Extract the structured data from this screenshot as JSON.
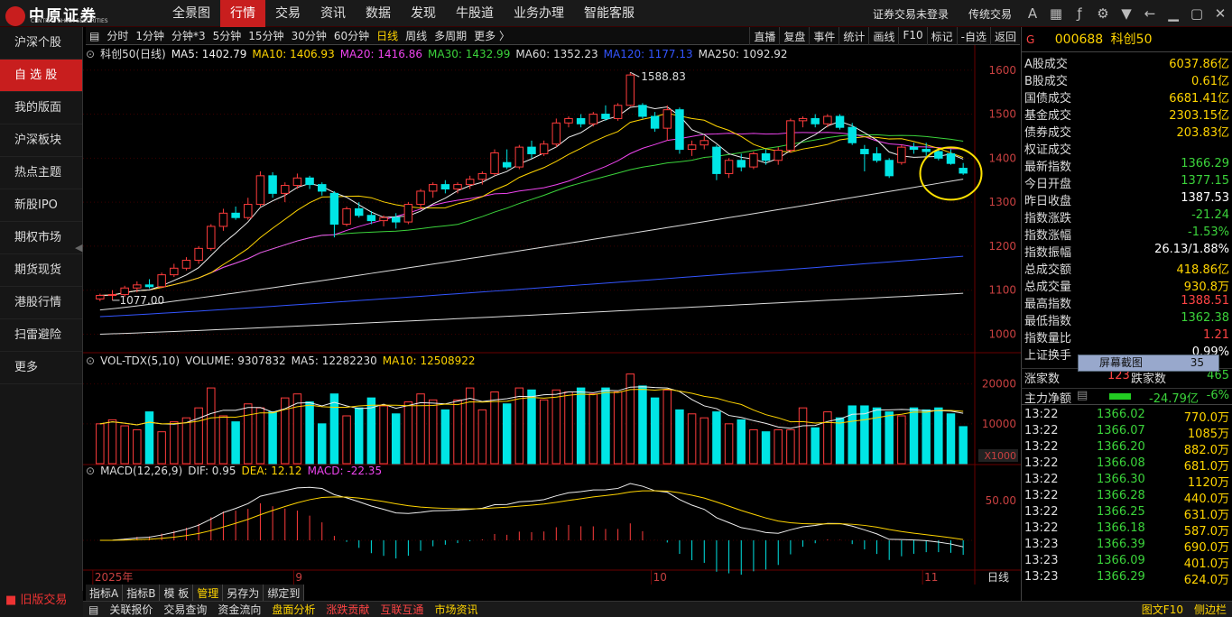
{
  "app": {
    "logo_text": "中原证券",
    "logo_subtext": "CENTRAL CHINA SECURITIES"
  },
  "menu": [
    "全景图",
    "行情",
    "交易",
    "资讯",
    "数据",
    "发现",
    "牛股道",
    "业务办理",
    "智能客服"
  ],
  "menu_active": "行情",
  "topright": {
    "login_status": "证券交易未登录",
    "mode": "传统交易"
  },
  "sidebar": [
    "沪深个股",
    "自 选 股",
    "我的版面",
    "沪深板块",
    "热点主题",
    "新股IPO",
    "期权市场",
    "期货现货",
    "港股行情",
    "扫雷避险",
    "更多"
  ],
  "sidebar_active": "自 选 股",
  "old_version": "旧版交易",
  "periods": [
    "分时",
    "1分钟",
    "分钟*3",
    "5分钟",
    "15分钟",
    "30分钟",
    "60分钟",
    "日线",
    "周线",
    "多周期",
    "更多 〉"
  ],
  "period_active": "日线",
  "chart_tools": [
    "直播",
    "复盘",
    "事件",
    "统计",
    "画线",
    "F10",
    "标记",
    "-自选",
    "返回"
  ],
  "ma_legend": [
    {
      "text": "科创50(日线)",
      "color": "#dddddd"
    },
    {
      "text": "MA5: 1402.79",
      "color": "#eeeeee"
    },
    {
      "text": "MA10: 1406.93",
      "color": "#ffd400"
    },
    {
      "text": "MA20: 1416.86",
      "color": "#ee44ee"
    },
    {
      "text": "MA30: 1432.99",
      "color": "#3bd33b"
    },
    {
      "text": "MA60: 1352.23",
      "color": "#dddddd"
    },
    {
      "text": "MA120: 1177.13",
      "color": "#3355ff"
    },
    {
      "text": "MA250: 1092.92",
      "color": "#dddddd"
    }
  ],
  "vol_legend": [
    {
      "text": "VOL-TDX(5,10)",
      "color": "#dddddd"
    },
    {
      "text": "VOLUME: 9307832",
      "color": "#dddddd"
    },
    {
      "text": "MA5: 12282230",
      "color": "#dddddd"
    },
    {
      "text": "MA10: 12508922",
      "color": "#ffd400"
    }
  ],
  "macd_legend": [
    {
      "text": "MACD(12,26,9)",
      "color": "#dddddd"
    },
    {
      "text": "DIF: 0.95",
      "color": "#dddddd"
    },
    {
      "text": "DEA: 12.12",
      "color": "#ffd400"
    },
    {
      "text": "MACD: -22.35",
      "color": "#ee44ee"
    }
  ],
  "price_axis": [
    "1600",
    "1500",
    "1400",
    "1300",
    "1200",
    "1100",
    "1000"
  ],
  "vol_axis": [
    "20000",
    "10000",
    "X1000"
  ],
  "macd_axis": [
    "50.00"
  ],
  "date_axis": [
    "2025年",
    "9",
    "10",
    "11"
  ],
  "period_label": "日线",
  "annotations": {
    "high": "1588.83",
    "low": "1077.00"
  },
  "bottom_tabs": [
    "指标A",
    "指标B",
    "模 板",
    "管理",
    "另存为",
    "绑定到"
  ],
  "bottom_tab_active": "管理",
  "statusbar": [
    {
      "text": "关联报价",
      "color": "#dddddd"
    },
    {
      "text": "交易查询",
      "color": "#dddddd"
    },
    {
      "text": "资金流向",
      "color": "#dddddd"
    },
    {
      "text": "盘面分析",
      "color": "#ffd400"
    },
    {
      "text": "涨跌贡献",
      "color": "#ff4444"
    },
    {
      "text": "互联互通",
      "color": "#ff4444"
    },
    {
      "text": "市场资讯",
      "color": "#ffd400"
    },
    {
      "text": "图文F10",
      "color": "#ffd400"
    },
    {
      "text": "侧边栏",
      "color": "#ffd400"
    }
  ],
  "stock": {
    "code": "000688",
    "name": "科创50",
    "marker": "G"
  },
  "quote_rows": [
    {
      "label": "A股成交",
      "value": "6037.86亿",
      "color": "#ffd400"
    },
    {
      "label": "B股成交",
      "value": "0.61亿",
      "color": "#ffd400"
    },
    {
      "label": "国债成交",
      "value": "6681.41亿",
      "color": "#ffd400"
    },
    {
      "label": "基金成交",
      "value": "2303.15亿",
      "color": "#ffd400"
    },
    {
      "label": "债券成交",
      "value": "203.83亿",
      "color": "#ffd400"
    },
    {
      "label": "权证成交",
      "value": "",
      "color": "#ffd400"
    },
    {
      "label": "最新指数",
      "value": "1366.29",
      "color": "#3bd33b"
    },
    {
      "label": "今日开盘",
      "value": "1377.15",
      "color": "#3bd33b"
    },
    {
      "label": "昨日收盘",
      "value": "1387.53",
      "color": "#ffffff"
    },
    {
      "label": "指数涨跌",
      "value": "-21.24",
      "color": "#3bd33b"
    },
    {
      "label": "指数涨幅",
      "value": "-1.53%",
      "color": "#3bd33b"
    },
    {
      "label": "指数振幅",
      "value": "26.13/1.88%",
      "color": "#ffffff"
    },
    {
      "label": "总成交额",
      "value": "418.86亿",
      "color": "#ffd400"
    },
    {
      "label": "总成交量",
      "value": "930.8万",
      "color": "#ffd400"
    },
    {
      "label": "最高指数",
      "value": "1388.51",
      "color": "#ff4444"
    },
    {
      "label": "最低指数",
      "value": "1362.38",
      "color": "#3bd33b"
    },
    {
      "label": "指数量比",
      "value": "1.21",
      "color": "#ff4444"
    },
    {
      "label": "上证换手",
      "value": "0.99%",
      "color": "#ffffff"
    }
  ],
  "updown": {
    "label_up": "涨家数",
    "value_up": "123",
    "label_down": "跌家数",
    "value_down": "465"
  },
  "main_flow": {
    "label": "主力净额",
    "value": "-24.79亿",
    "pct": "-6%"
  },
  "popup": {
    "text": "屏幕截图",
    "count": "35"
  },
  "ticks": [
    {
      "time": "13:22",
      "price": "1366.02",
      "vol": "770.0万"
    },
    {
      "time": "13:22",
      "price": "1366.07",
      "vol": "1085万"
    },
    {
      "time": "13:22",
      "price": "1366.20",
      "vol": "882.0万"
    },
    {
      "time": "13:22",
      "price": "1366.08",
      "vol": "681.0万"
    },
    {
      "time": "13:22",
      "price": "1366.30",
      "vol": "1120万"
    },
    {
      "time": "13:22",
      "price": "1366.28",
      "vol": "440.0万"
    },
    {
      "time": "13:22",
      "price": "1366.25",
      "vol": "631.0万"
    },
    {
      "time": "13:22",
      "price": "1366.18",
      "vol": "587.0万"
    },
    {
      "time": "13:23",
      "price": "1366.39",
      "vol": "690.0万"
    },
    {
      "time": "13:23",
      "price": "1366.09",
      "vol": "401.0万"
    },
    {
      "time": "13:23",
      "price": "1366.29",
      "vol": "624.0万"
    }
  ],
  "chart_data": {
    "type": "candlestick",
    "ylim": [
      960,
      1620
    ],
    "candles": [
      [
        1080,
        1092,
        1075,
        1088
      ],
      [
        1088,
        1100,
        1077,
        1090
      ],
      [
        1090,
        1110,
        1085,
        1105
      ],
      [
        1105,
        1120,
        1095,
        1112
      ],
      [
        1112,
        1125,
        1104,
        1108
      ],
      [
        1108,
        1140,
        1105,
        1135
      ],
      [
        1135,
        1160,
        1130,
        1150
      ],
      [
        1150,
        1175,
        1145,
        1168
      ],
      [
        1168,
        1200,
        1160,
        1195
      ],
      [
        1195,
        1250,
        1190,
        1245
      ],
      [
        1245,
        1285,
        1235,
        1275
      ],
      [
        1275,
        1290,
        1260,
        1265
      ],
      [
        1265,
        1310,
        1260,
        1295
      ],
      [
        1295,
        1370,
        1290,
        1360
      ],
      [
        1360,
        1368,
        1310,
        1320
      ],
      [
        1320,
        1345,
        1300,
        1338
      ],
      [
        1338,
        1365,
        1330,
        1355
      ],
      [
        1355,
        1360,
        1330,
        1340
      ],
      [
        1340,
        1345,
        1315,
        1325
      ],
      [
        1320,
        1325,
        1220,
        1250
      ],
      [
        1250,
        1290,
        1245,
        1285
      ],
      [
        1285,
        1300,
        1265,
        1270
      ],
      [
        1270,
        1280,
        1250,
        1258
      ],
      [
        1258,
        1270,
        1245,
        1265
      ],
      [
        1265,
        1275,
        1240,
        1255
      ],
      [
        1255,
        1300,
        1250,
        1295
      ],
      [
        1295,
        1330,
        1285,
        1325
      ],
      [
        1325,
        1345,
        1310,
        1340
      ],
      [
        1340,
        1350,
        1320,
        1330
      ],
      [
        1330,
        1345,
        1320,
        1340
      ],
      [
        1340,
        1360,
        1330,
        1352
      ],
      [
        1352,
        1370,
        1340,
        1365
      ],
      [
        1365,
        1420,
        1360,
        1412
      ],
      [
        1390,
        1420,
        1375,
        1380
      ],
      [
        1380,
        1430,
        1375,
        1425
      ],
      [
        1425,
        1440,
        1400,
        1410
      ],
      [
        1410,
        1440,
        1405,
        1432
      ],
      [
        1432,
        1490,
        1425,
        1480
      ],
      [
        1480,
        1495,
        1470,
        1490
      ],
      [
        1490,
        1500,
        1470,
        1478
      ],
      [
        1478,
        1505,
        1472,
        1500
      ],
      [
        1500,
        1520,
        1485,
        1490
      ],
      [
        1490,
        1525,
        1485,
        1520
      ],
      [
        1520,
        1595,
        1518,
        1589
      ],
      [
        1520,
        1525,
        1490,
        1495
      ],
      [
        1495,
        1505,
        1460,
        1468
      ],
      [
        1468,
        1520,
        1440,
        1510
      ],
      [
        1510,
        1515,
        1410,
        1420
      ],
      [
        1420,
        1440,
        1405,
        1430
      ],
      [
        1430,
        1450,
        1420,
        1440
      ],
      [
        1425,
        1430,
        1350,
        1365
      ],
      [
        1365,
        1400,
        1355,
        1395
      ],
      [
        1395,
        1410,
        1370,
        1380
      ],
      [
        1380,
        1415,
        1375,
        1410
      ],
      [
        1410,
        1420,
        1385,
        1395
      ],
      [
        1395,
        1425,
        1385,
        1418
      ],
      [
        1418,
        1490,
        1412,
        1485
      ],
      [
        1485,
        1495,
        1470,
        1490
      ],
      [
        1490,
        1500,
        1470,
        1478
      ],
      [
        1478,
        1500,
        1470,
        1495
      ],
      [
        1495,
        1500,
        1465,
        1470
      ],
      [
        1470,
        1480,
        1430,
        1435
      ],
      [
        1420,
        1430,
        1370,
        1410
      ],
      [
        1410,
        1425,
        1390,
        1395
      ],
      [
        1395,
        1400,
        1355,
        1360
      ],
      [
        1390,
        1430,
        1385,
        1425
      ],
      [
        1425,
        1435,
        1410,
        1420
      ],
      [
        1420,
        1435,
        1405,
        1415
      ],
      [
        1415,
        1420,
        1395,
        1400
      ],
      [
        1410,
        1420,
        1385,
        1388
      ],
      [
        1377,
        1389,
        1362,
        1366
      ]
    ],
    "ma_values": {
      "MA5": 1402.79,
      "MA10": 1406.93,
      "MA20": 1416.86,
      "MA30": 1432.99,
      "MA60": 1352.23,
      "MA120": 1177.13,
      "MA250": 1092.92
    },
    "high_mark": 1588.83,
    "low_mark": 1077.0,
    "volume": {
      "ylim": [
        0,
        24000
      ],
      "values": [
        10000,
        11000,
        9500,
        8500,
        13000,
        8000,
        10500,
        11500,
        14000,
        19000,
        12000,
        10500,
        15000,
        14000,
        13000,
        16500,
        17500,
        15500,
        10000,
        17500,
        12000,
        14000,
        16500,
        14500,
        12500,
        15500,
        17500,
        16000,
        13500,
        16000,
        19000,
        13500,
        18000,
        15000,
        19000,
        18500,
        16000,
        18500,
        18000,
        19000,
        17500,
        19000,
        18000,
        22500,
        19500,
        16500,
        18500,
        13500,
        12500,
        11500,
        13000,
        10000,
        11000,
        8500,
        8000,
        8500,
        8500,
        14000,
        9000,
        13000,
        11500,
        14500,
        14500,
        14000,
        13000,
        12000,
        14000,
        13500,
        14000,
        12500,
        9300
      ],
      "MA5": 12282230,
      "MA10": 12508922
    },
    "macd": {
      "DIF": 0.95,
      "DEA": 12.12,
      "MACD": -22.35
    }
  }
}
